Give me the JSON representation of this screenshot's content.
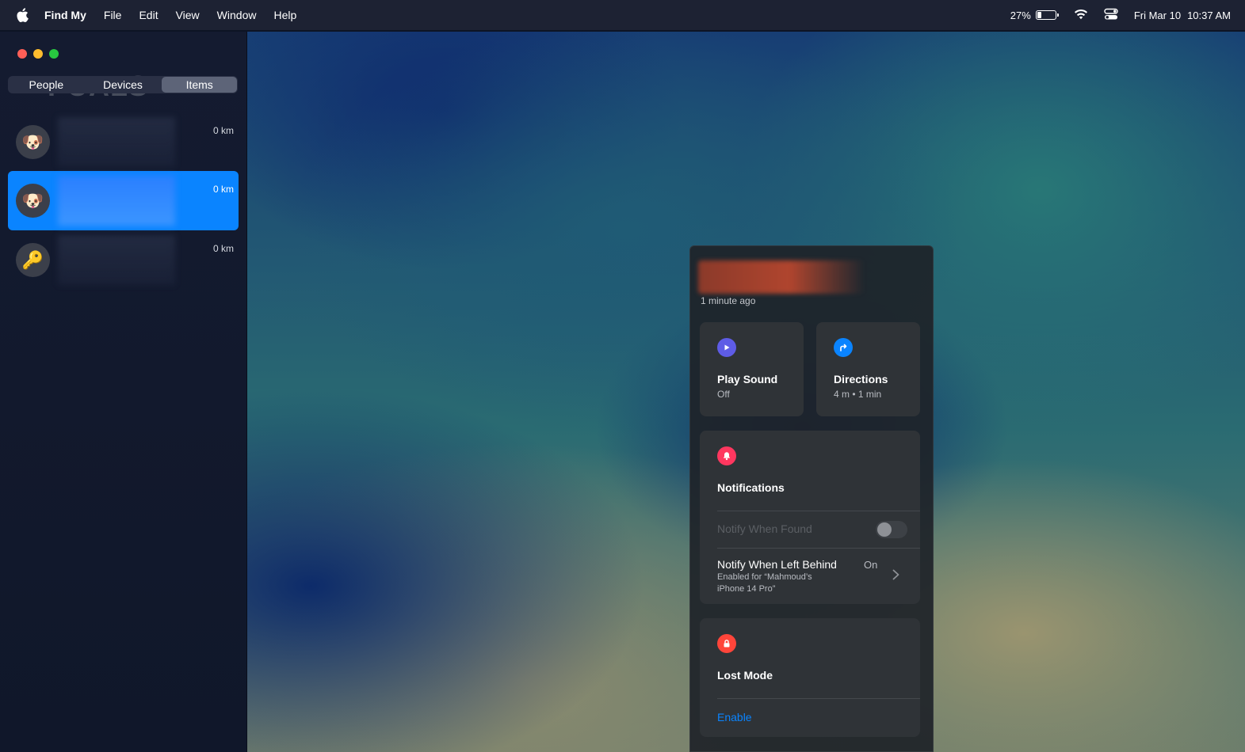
{
  "menubar": {
    "apple_icon": "apple-logo-icon",
    "app_name": "Find My",
    "menus": [
      "File",
      "Edit",
      "View",
      "Window",
      "Help"
    ],
    "battery_percent": "27%",
    "battery_level": 0.27,
    "date": "Fri Mar 10",
    "time": "10:37 AM"
  },
  "watermark": "PUALS",
  "sidebar": {
    "tabs": [
      "People",
      "Devices",
      "Items"
    ],
    "active_tab": "Items",
    "items": [
      {
        "icon": "dog-icon",
        "glyph": "🐶",
        "distance": "0 km",
        "selected": false
      },
      {
        "icon": "dog-icon",
        "glyph": "🐶",
        "distance": "0 km",
        "selected": true
      },
      {
        "icon": "key-icon",
        "glyph": "🔑",
        "distance": "0 km",
        "selected": false
      }
    ]
  },
  "panel": {
    "updated": "1 minute ago",
    "play_sound": {
      "title": "Play Sound",
      "status": "Off"
    },
    "directions": {
      "title": "Directions",
      "detail": "4 m • 1 min"
    },
    "notifications": {
      "title": "Notifications",
      "notify_when_found": "Notify When Found",
      "notify_left_behind": "Notify When Left Behind",
      "left_behind_status": "On",
      "left_behind_detail_1": "Enabled for “Mahmoud’s",
      "left_behind_detail_2": "iPhone 14 Pro”"
    },
    "lost_mode": {
      "title": "Lost Mode",
      "action": "Enable"
    }
  },
  "colors": {
    "accent": "#0a84ff",
    "play_icon": "#5e5ce6",
    "directions_icon": "#0a84ff",
    "notifications_icon": "#ff375f",
    "lost_mode_icon": "#ff453a"
  }
}
